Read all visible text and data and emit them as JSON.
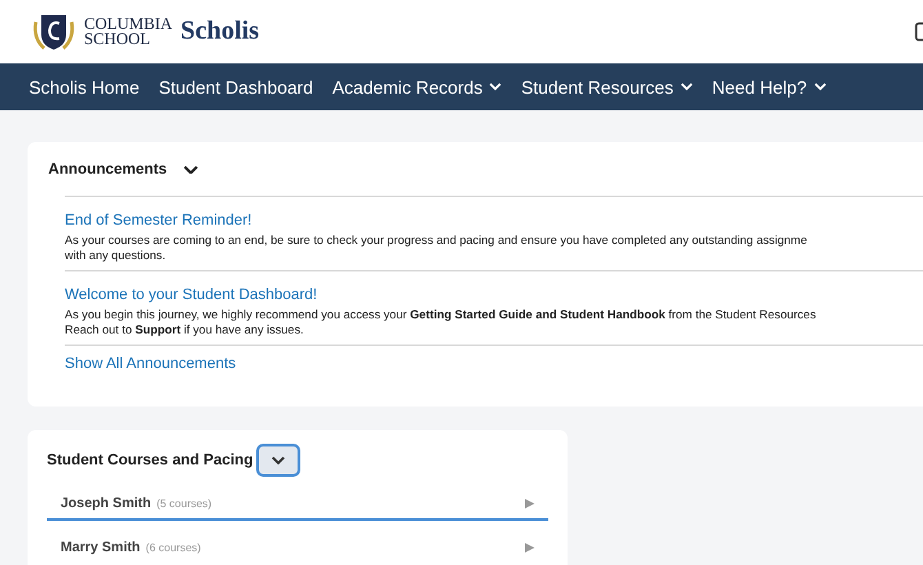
{
  "logo": {
    "line_1": "COLUMBIA",
    "line_2": "SCHOOL",
    "product": "Scholis"
  },
  "nav": [
    {
      "label": "Scholis Home",
      "dropdown": false
    },
    {
      "label": "Student Dashboard",
      "dropdown": false
    },
    {
      "label": "Academic Records",
      "dropdown": true
    },
    {
      "label": "Student Resources",
      "dropdown": true
    },
    {
      "label": "Need Help?",
      "dropdown": true
    }
  ],
  "announcements": {
    "title": "Announcements",
    "expanded": true,
    "items": [
      {
        "title": "End of Semester Reminder!",
        "body_lines": [
          "As your courses are coming to an end, be sure to check your progress and pacing and ensure you have completed any outstanding assignme",
          "with any questions."
        ]
      },
      {
        "title": "Welcome to your Student Dashboard!",
        "body_lines": [
          "As you begin this journey, we highly recommend you access your **Getting Started Guide and Student Handbook** from the Student Resources",
          "Reach out to **Support** if you have any issues."
        ]
      }
    ],
    "show_all": "Show All Announcements"
  },
  "courses": {
    "title": "Student Courses and Pacing",
    "expanded": true,
    "students": [
      {
        "name": "Joseph Smith",
        "count": "(5 courses)",
        "selected": true
      },
      {
        "name": "Marry Smith",
        "count": "(6 courses)",
        "selected": false
      }
    ]
  }
}
